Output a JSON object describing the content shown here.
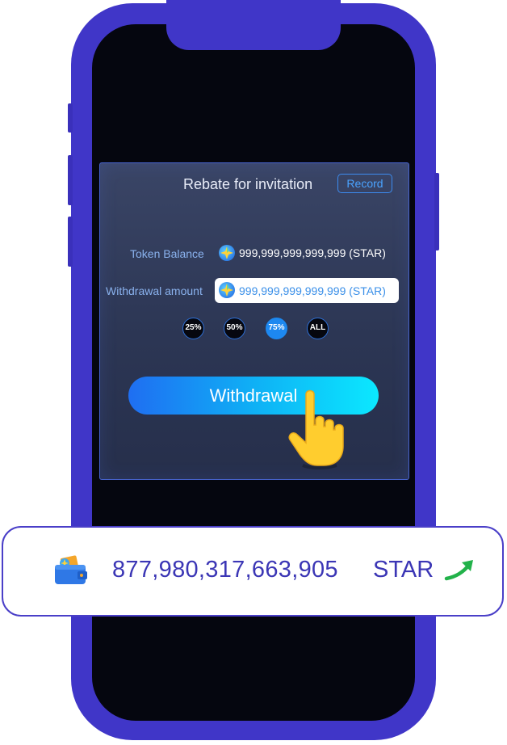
{
  "card": {
    "title": "Rebate for invitation",
    "record_label": "Record"
  },
  "balance": {
    "label": "Token Balance",
    "value": "999,999,999,999,999 (STAR)",
    "icon": "star-token-icon"
  },
  "withdrawal": {
    "label": "Withdrawal amount",
    "value": "999,999,999,999,999 (STAR)",
    "icon": "star-token-icon"
  },
  "percent_options": [
    {
      "label": "25%",
      "active": false
    },
    {
      "label": "50%",
      "active": false
    },
    {
      "label": "75%",
      "active": true
    },
    {
      "label": "ALL",
      "active": false
    }
  ],
  "withdraw_button": {
    "label": "Withdrawal"
  },
  "banner": {
    "amount": "877,980,317,663,905",
    "unit": "STAR",
    "wallet_icon": "wallet-icon",
    "trend_icon": "trend-up-arrow-icon"
  },
  "colors": {
    "phone_frame": "#4036c8",
    "screen_bg": "#05060f",
    "accent_blue": "#1d88f0",
    "banner_text": "#3b36b5",
    "trend_green": "#22b24a",
    "hand_yellow": "#ffcd2e"
  }
}
